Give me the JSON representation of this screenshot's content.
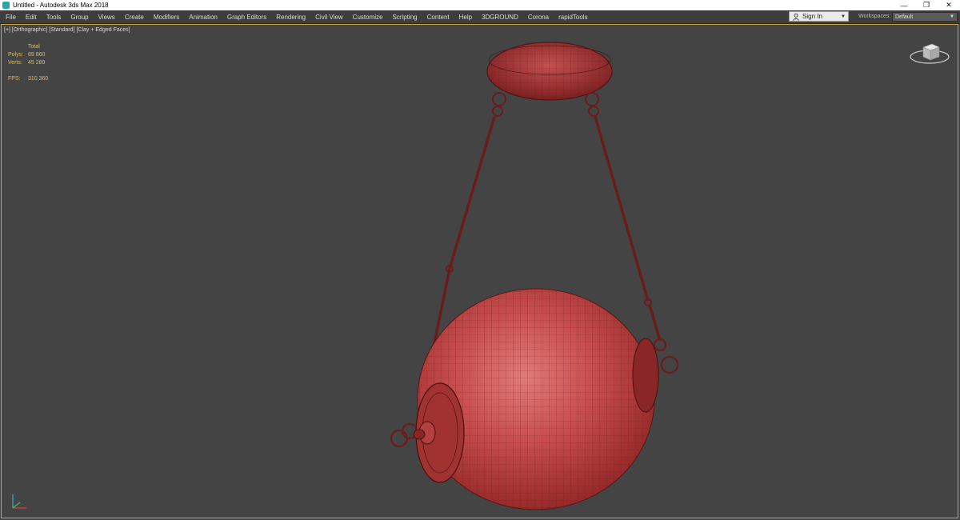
{
  "window": {
    "title": "Untitled - Autodesk 3ds Max 2018",
    "controls": [
      "—",
      "❐",
      "✕"
    ]
  },
  "menu": {
    "items": [
      "File",
      "Edit",
      "Tools",
      "Group",
      "Views",
      "Create",
      "Modifiers",
      "Animation",
      "Graph Editors",
      "Rendering",
      "Civil View",
      "Customize",
      "Scripting",
      "Content",
      "Help",
      "3DGROUND",
      "Corona",
      "rapidTools"
    ]
  },
  "account": {
    "signin_label": "Sign In",
    "workspaces_label": "Workspaces:",
    "workspace_value": "Default"
  },
  "viewport": {
    "label": "[+] [Orthographic] [Standard] [Clay + Edged Faces]",
    "stats": {
      "header": "Total",
      "polys_label": "Polys:",
      "polys_value": "89 860",
      "verts_label": "Verts:",
      "verts_value": "45 289",
      "fps_label": "FPS:",
      "fps_value": "310,360"
    },
    "colors": {
      "background": "#444444",
      "border": "#c9a53a",
      "stats": "#e6c21d",
      "clay": "#b03a3a"
    }
  }
}
